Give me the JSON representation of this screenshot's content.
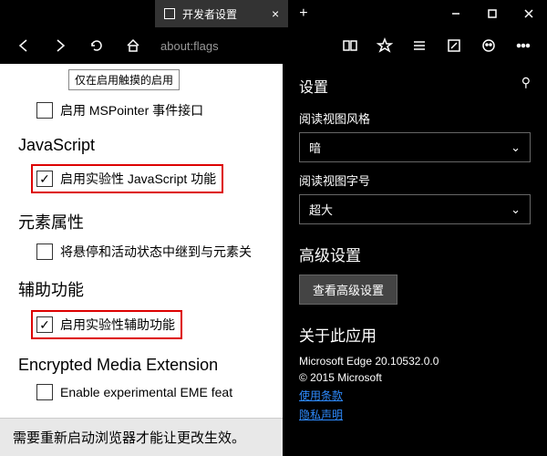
{
  "titlebar": {
    "tab_title": "开发者设置",
    "address": "about:flags"
  },
  "page": {
    "partial_top": "仅在启用触摸的启用",
    "mspointer": "启用 MSPointer 事件接口",
    "js_heading": "JavaScript",
    "js_experimental": "启用实验性 JavaScript 功能",
    "element_attr_heading": "元素属性",
    "element_attr_item": "将悬停和活动状态中继到与元素关",
    "accessibility_heading": "辅助功能",
    "accessibility_item": "启用实验性辅助功能",
    "eme_heading": "Encrypted Media Extension",
    "eme_item": "Enable experimental EME feat",
    "restart_notice": "需要重新启动浏览器才能让更改生效。"
  },
  "panel": {
    "title": "设置",
    "reading_style_label": "阅读视图风格",
    "reading_style_value": "暗",
    "reading_size_label": "阅读视图字号",
    "reading_size_value": "超大",
    "advanced_heading": "高级设置",
    "advanced_button": "查看高级设置",
    "about_heading": "关于此应用",
    "about_version": "Microsoft Edge 20.10532.0.0",
    "about_copyright": "© 2015 Microsoft",
    "terms_link": "使用条款",
    "privacy_link": "隐私声明"
  }
}
